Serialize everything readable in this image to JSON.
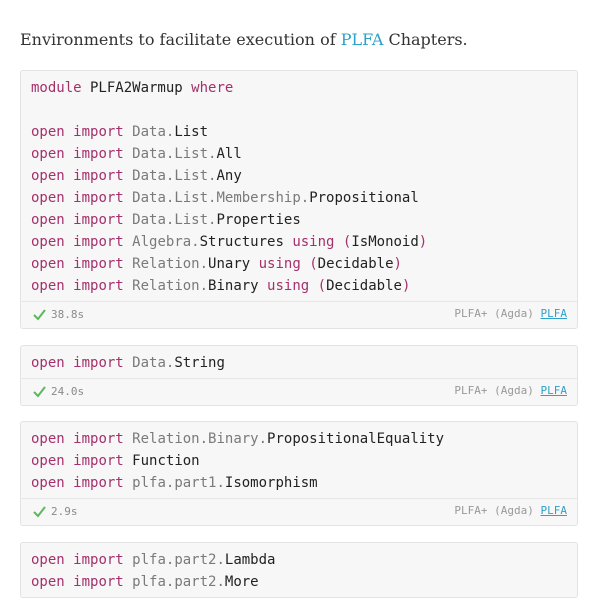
{
  "intro": {
    "text_before": "Environments to facilitate execution of ",
    "link": "PLFA",
    "text_after": " Chapters."
  },
  "cells": [
    {
      "lines": [
        {
          "parts": [
            {
              "t": "module",
              "c": "kw"
            },
            {
              "t": " PLFA2Warmup ",
              "c": "ent"
            },
            {
              "t": "where",
              "c": "kw"
            }
          ]
        },
        {
          "parts": []
        },
        {
          "parts": [
            {
              "t": "open",
              "c": "kw"
            },
            {
              "t": " ",
              "c": "ent"
            },
            {
              "t": "import",
              "c": "kw"
            },
            {
              "t": " ",
              "c": "ent"
            },
            {
              "t": "Data.",
              "c": "mod"
            },
            {
              "t": "List",
              "c": "ent"
            }
          ]
        },
        {
          "parts": [
            {
              "t": "open",
              "c": "kw"
            },
            {
              "t": " ",
              "c": "ent"
            },
            {
              "t": "import",
              "c": "kw"
            },
            {
              "t": " ",
              "c": "ent"
            },
            {
              "t": "Data.List.",
              "c": "mod"
            },
            {
              "t": "All",
              "c": "ent"
            }
          ]
        },
        {
          "parts": [
            {
              "t": "open",
              "c": "kw"
            },
            {
              "t": " ",
              "c": "ent"
            },
            {
              "t": "import",
              "c": "kw"
            },
            {
              "t": " ",
              "c": "ent"
            },
            {
              "t": "Data.List.",
              "c": "mod"
            },
            {
              "t": "Any",
              "c": "ent"
            }
          ]
        },
        {
          "parts": [
            {
              "t": "open",
              "c": "kw"
            },
            {
              "t": " ",
              "c": "ent"
            },
            {
              "t": "import",
              "c": "kw"
            },
            {
              "t": " ",
              "c": "ent"
            },
            {
              "t": "Data.List.Membership.",
              "c": "mod"
            },
            {
              "t": "Propositional",
              "c": "ent"
            }
          ]
        },
        {
          "parts": [
            {
              "t": "open",
              "c": "kw"
            },
            {
              "t": " ",
              "c": "ent"
            },
            {
              "t": "import",
              "c": "kw"
            },
            {
              "t": " ",
              "c": "ent"
            },
            {
              "t": "Data.List.",
              "c": "mod"
            },
            {
              "t": "Properties",
              "c": "ent"
            }
          ]
        },
        {
          "parts": [
            {
              "t": "open",
              "c": "kw"
            },
            {
              "t": " ",
              "c": "ent"
            },
            {
              "t": "import",
              "c": "kw"
            },
            {
              "t": " ",
              "c": "ent"
            },
            {
              "t": "Algebra.",
              "c": "mod"
            },
            {
              "t": "Structures ",
              "c": "ent"
            },
            {
              "t": "using",
              "c": "kw"
            },
            {
              "t": " ",
              "c": "ent"
            },
            {
              "t": "(",
              "c": "par"
            },
            {
              "t": "IsMonoid",
              "c": "ent"
            },
            {
              "t": ")",
              "c": "par"
            }
          ]
        },
        {
          "parts": [
            {
              "t": "open",
              "c": "kw"
            },
            {
              "t": " ",
              "c": "ent"
            },
            {
              "t": "import",
              "c": "kw"
            },
            {
              "t": " ",
              "c": "ent"
            },
            {
              "t": "Relation.",
              "c": "mod"
            },
            {
              "t": "Unary ",
              "c": "ent"
            },
            {
              "t": "using",
              "c": "kw"
            },
            {
              "t": " ",
              "c": "ent"
            },
            {
              "t": "(",
              "c": "par"
            },
            {
              "t": "Decidable",
              "c": "ent"
            },
            {
              "t": ")",
              "c": "par"
            }
          ]
        },
        {
          "parts": [
            {
              "t": "open",
              "c": "kw"
            },
            {
              "t": " ",
              "c": "ent"
            },
            {
              "t": "import",
              "c": "kw"
            },
            {
              "t": " ",
              "c": "ent"
            },
            {
              "t": "Relation.",
              "c": "mod"
            },
            {
              "t": "Binary ",
              "c": "ent"
            },
            {
              "t": "using",
              "c": "kw"
            },
            {
              "t": " ",
              "c": "ent"
            },
            {
              "t": "(",
              "c": "par"
            },
            {
              "t": "Decidable",
              "c": "ent"
            },
            {
              "t": ")",
              "c": "par"
            }
          ]
        }
      ],
      "time": "38.8s",
      "backend": "PLFA+ (Agda)",
      "backend_link": "PLFA"
    },
    {
      "lines": [
        {
          "parts": [
            {
              "t": "open",
              "c": "kw"
            },
            {
              "t": " ",
              "c": "ent"
            },
            {
              "t": "import",
              "c": "kw"
            },
            {
              "t": " ",
              "c": "ent"
            },
            {
              "t": "Data.",
              "c": "mod"
            },
            {
              "t": "String",
              "c": "ent"
            }
          ]
        }
      ],
      "time": "24.0s",
      "backend": "PLFA+ (Agda)",
      "backend_link": "PLFA"
    },
    {
      "lines": [
        {
          "parts": [
            {
              "t": "open",
              "c": "kw"
            },
            {
              "t": " ",
              "c": "ent"
            },
            {
              "t": "import",
              "c": "kw"
            },
            {
              "t": " ",
              "c": "ent"
            },
            {
              "t": "Relation.Binary.",
              "c": "mod"
            },
            {
              "t": "PropositionalEquality",
              "c": "ent"
            }
          ]
        },
        {
          "parts": [
            {
              "t": "open",
              "c": "kw"
            },
            {
              "t": " ",
              "c": "ent"
            },
            {
              "t": "import",
              "c": "kw"
            },
            {
              "t": " ",
              "c": "ent"
            },
            {
              "t": "Function",
              "c": "ent"
            }
          ]
        },
        {
          "parts": [
            {
              "t": "open",
              "c": "kw"
            },
            {
              "t": " ",
              "c": "ent"
            },
            {
              "t": "import",
              "c": "kw"
            },
            {
              "t": " ",
              "c": "ent"
            },
            {
              "t": "plfa.part1.",
              "c": "mod"
            },
            {
              "t": "Isomorphism",
              "c": "ent"
            }
          ]
        }
      ],
      "time": "2.9s",
      "backend": "PLFA+ (Agda)",
      "backend_link": "PLFA"
    },
    {
      "lines": [
        {
          "parts": [
            {
              "t": "open",
              "c": "kw"
            },
            {
              "t": " ",
              "c": "ent"
            },
            {
              "t": "import",
              "c": "kw"
            },
            {
              "t": " ",
              "c": "ent"
            },
            {
              "t": "plfa.part2.",
              "c": "mod"
            },
            {
              "t": "Lambda",
              "c": "ent"
            }
          ]
        },
        {
          "parts": [
            {
              "t": "open",
              "c": "kw"
            },
            {
              "t": " ",
              "c": "ent"
            },
            {
              "t": "import",
              "c": "kw"
            },
            {
              "t": " ",
              "c": "ent"
            },
            {
              "t": "plfa.part2.",
              "c": "mod"
            },
            {
              "t": "More",
              "c": "ent"
            }
          ]
        }
      ]
    }
  ],
  "colors": {
    "keyword": "#a4306c",
    "module_path": "#7a7a7a",
    "link": "#2ea1c9",
    "check": "#5cb85c"
  },
  "icons": {
    "status": "check-icon"
  }
}
